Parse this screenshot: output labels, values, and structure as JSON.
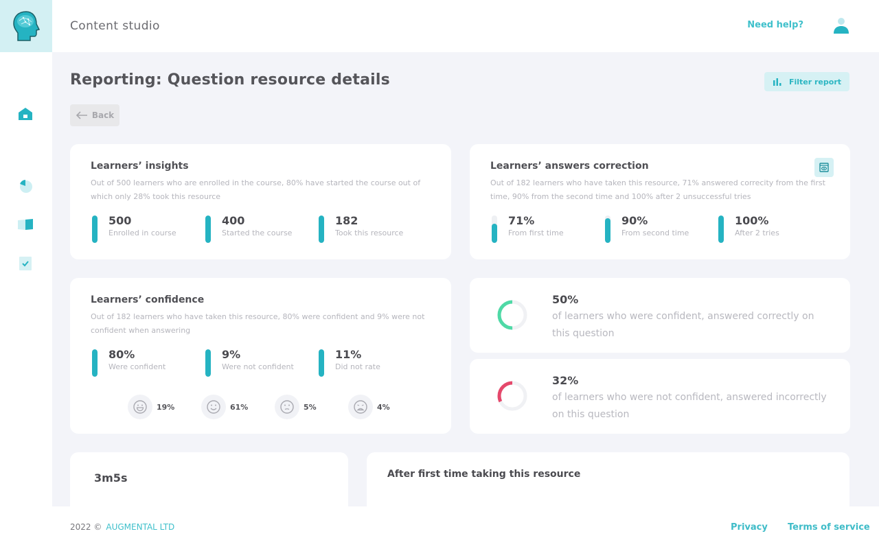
{
  "header": {
    "app_title": "Content studio",
    "help_label": "Need help?"
  },
  "sidebar": {
    "items": [
      {
        "name": "home",
        "icon": "home-icon"
      },
      {
        "name": "reports",
        "icon": "pie-chart-icon"
      },
      {
        "name": "library",
        "icon": "book-icon"
      },
      {
        "name": "tasks",
        "icon": "checklist-icon"
      }
    ]
  },
  "page": {
    "title": "Reporting: Question resource details",
    "back_label": "Back",
    "filter_label": "Filter report"
  },
  "insights": {
    "title": "Learners’ insights",
    "description": "Out of 500 learners who are enrolled in the course, 80% have started the course out of which only 28% took this resource",
    "stats": [
      {
        "value": "500",
        "label": "Enrolled in course",
        "fill": 1.0
      },
      {
        "value": "400",
        "label": "Started the course",
        "fill": 1.0
      },
      {
        "value": "182",
        "label": "Took this resource",
        "fill": 1.0
      }
    ]
  },
  "correction": {
    "title": "Learners’ answers correction",
    "description": "Out of 182 learners who have taken this resource, 71% answered correcity from the first time, 90% from the second time and 100% after 2 unsuccessful tries",
    "stats": [
      {
        "value": "71%",
        "label": "From first time",
        "fill": 0.71
      },
      {
        "value": "90%",
        "label": "From second time",
        "fill": 0.9
      },
      {
        "value": "100%",
        "label": "After 2 tries",
        "fill": 1.0
      }
    ]
  },
  "confidence": {
    "title": "Learners’ confidence",
    "description": "Out of 182 learners who have taken this resource, 80% were confident and 9% were not confident when answering",
    "stats": [
      {
        "value": "80%",
        "label": "Were confident",
        "fill": 1.0
      },
      {
        "value": "9%",
        "label": "Were not confident",
        "fill": 1.0
      },
      {
        "value": "11%",
        "label": "Did not rate",
        "fill": 1.0
      }
    ],
    "ratings": [
      {
        "icon": "very-happy-face-icon",
        "percent": "19%"
      },
      {
        "icon": "happy-face-icon",
        "percent": "61%"
      },
      {
        "icon": "neutral-face-icon",
        "percent": "5%"
      },
      {
        "icon": "sad-face-icon",
        "percent": "4%"
      }
    ]
  },
  "confident_correct": {
    "value": "50%",
    "fraction": 0.5,
    "color": "#4fd9a6",
    "description": "of learners who were confident, answered correctly on this question"
  },
  "unconfident_incorrect": {
    "value": "32%",
    "fraction": 0.32,
    "color": "#e5486b",
    "description": "of learners who were not confident, answered incorrectly on this question"
  },
  "time_card": {
    "value": "3m5s"
  },
  "after_first": {
    "title": "After first time taking this resource"
  },
  "footer": {
    "year": "2022 ©",
    "company": "AUGMENTAL LTD",
    "privacy": "Privacy",
    "terms": "Terms of service"
  },
  "colors": {
    "accent": "#25b3c2",
    "accent_light": "#d6f1f4",
    "background": "#f3f4f9"
  }
}
